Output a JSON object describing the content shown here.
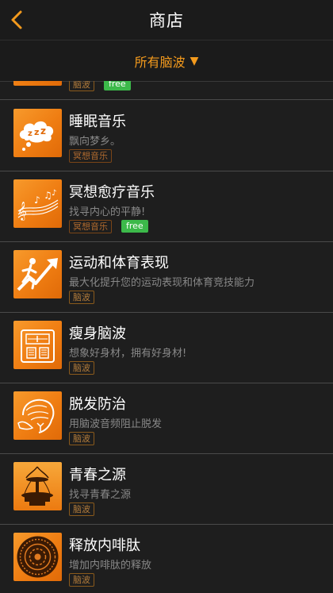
{
  "nav": {
    "title": "商店"
  },
  "filter": {
    "label": "所有脑波",
    "caret": "▼"
  },
  "items": [
    {
      "title": "",
      "subtitle": "",
      "tag": "脑波",
      "free": "free"
    },
    {
      "title": "睡眠音乐",
      "subtitle": "飘向梦乡。",
      "tag": "冥想音乐"
    },
    {
      "title": "冥想愈疗音乐",
      "subtitle": "找寻内心的平静!",
      "tag": "冥想音乐",
      "free": "free"
    },
    {
      "title": "运动和体育表现",
      "subtitle": "最大化提升您的运动表现和体育竞技能力",
      "tag": "脑波"
    },
    {
      "title": "瘦身脑波",
      "subtitle": "想象好身材，拥有好身材!",
      "tag": "脑波"
    },
    {
      "title": "脱发防治",
      "subtitle": "用脑波音频阻止脱发",
      "tag": "脑波"
    },
    {
      "title": "青春之源",
      "subtitle": "找寻青春之源",
      "tag": "脑波"
    },
    {
      "title": "释放内啡肽",
      "subtitle": "增加内啡肽的释放",
      "tag": "脑波"
    }
  ],
  "colors": {
    "accent": "#f39a1d",
    "free": "#3cb94a",
    "background": "#1e1e1e"
  }
}
